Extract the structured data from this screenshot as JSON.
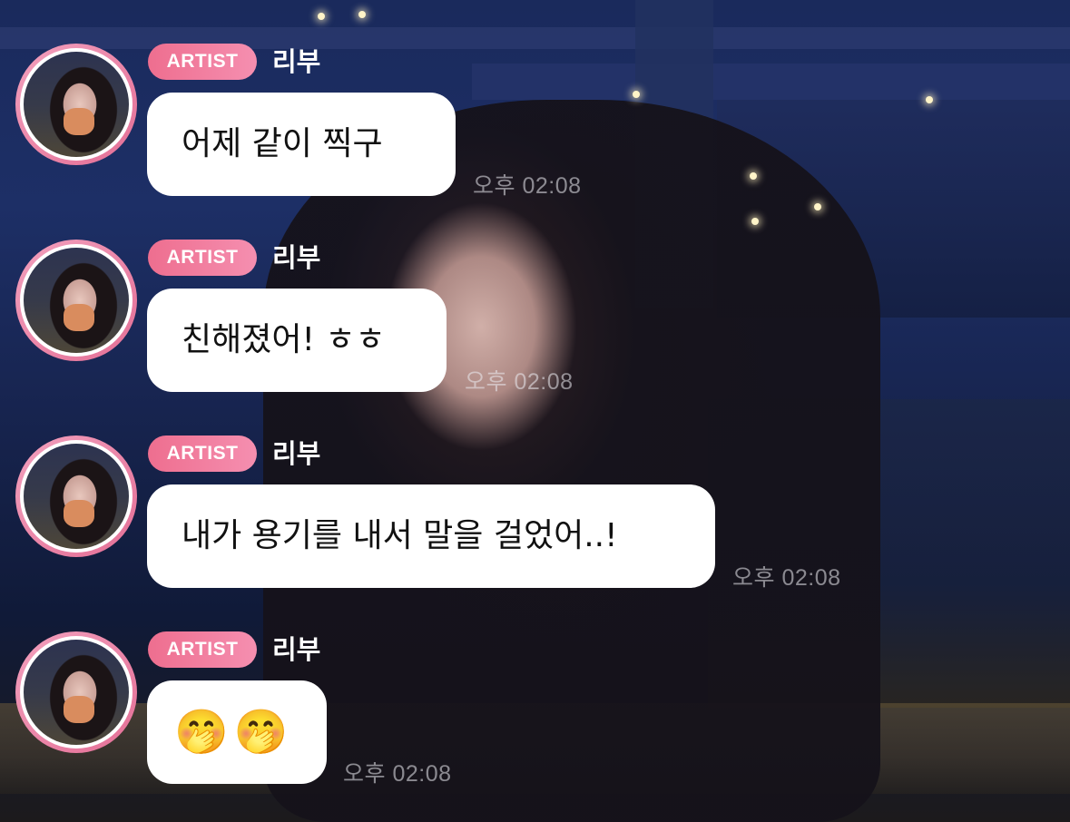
{
  "messages": [
    {
      "badge": "ARTIST",
      "sender": "리부",
      "text": "어제 같이 찍구",
      "time": "오후 02:08"
    },
    {
      "badge": "ARTIST",
      "sender": "리부",
      "text": "친해졌어! ㅎㅎ",
      "time": "오후 02:08"
    },
    {
      "badge": "ARTIST",
      "sender": "리부",
      "text": "내가 용기를 내서 말을 걸었어..!",
      "time": "오후 02:08"
    },
    {
      "badge": "ARTIST",
      "sender": "리부",
      "emoji": [
        "🤭",
        "🤭"
      ],
      "time": "오후 02:08"
    }
  ],
  "colors": {
    "badge": "#EE6E8F",
    "bubble": "#FFFFFF",
    "avatar_ring": "#E9829F"
  },
  "icons": {
    "message_avatar": "artist-profile-photo",
    "emoji": "face-with-hand-over-mouth"
  }
}
